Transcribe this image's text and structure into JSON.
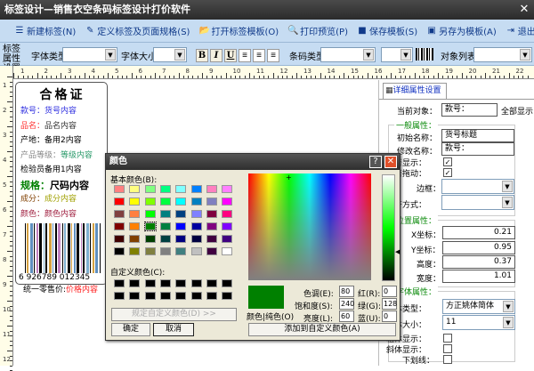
{
  "window": {
    "title": "标签设计—销售衣空条码标签设计打价软件",
    "close": "✕"
  },
  "toolbar": [
    {
      "label": "新建标签(N)",
      "icon": "new-label-icon",
      "glyph": "☰"
    },
    {
      "label": "定义标签及页面规格(S)",
      "icon": "page-setup-icon",
      "glyph": "✎"
    },
    {
      "label": "打开标签模板(O)",
      "icon": "open-folder-icon",
      "glyph": "📂"
    },
    {
      "label": "打印预览(P)",
      "icon": "magnifier-icon",
      "glyph": "🔍"
    },
    {
      "label": "保存模板(S)",
      "icon": "save-icon",
      "glyph": "■"
    },
    {
      "label": "另存为模板(A)",
      "icon": "save-as-icon",
      "glyph": "▣"
    },
    {
      "label": "退出(E)",
      "icon": "exit-icon",
      "glyph": "⇥"
    }
  ],
  "props_bar": {
    "section": "标签属性设置",
    "font_type": "字体类型",
    "font_size": "字体大小",
    "bold": "B",
    "italic": "I",
    "underline": "U",
    "barcode_type": "条码类型",
    "object_list": "对象列表"
  },
  "ruler": [
    "1",
    "2",
    "3",
    "4",
    "5",
    "6",
    "7",
    "8",
    "9",
    "10",
    "11",
    "12",
    "13",
    "14",
    "15",
    "16",
    "17",
    "18",
    "19",
    "20",
    "21",
    "22"
  ],
  "ruler_left": [
    "1",
    "2",
    "3",
    "4",
    "5",
    "6",
    "7",
    "8",
    "9",
    "10",
    "11",
    "12"
  ],
  "label": {
    "title": "合格证",
    "rows": [
      {
        "k": "款号：",
        "v": "货号内容",
        "kc": "#3030e0",
        "vc": "#3030e0"
      },
      {
        "k": "品名：",
        "v": "品名内容",
        "kc": "#ff3030",
        "vc": "#333333"
      },
      {
        "k": "产地：",
        "v": "备用2内容",
        "kc": "#000000",
        "vc": "#000000"
      },
      {
        "k": "产品等级：",
        "v": "等级内容",
        "kc": "#888888",
        "vc": "#2a9a6a"
      },
      {
        "k": "检验员",
        "v": "备用1内容",
        "kc": "#000000",
        "vc": "#000000"
      },
      {
        "k": "规格：",
        "v": "尺码内容",
        "kc": "#008000",
        "vc": "#000000"
      },
      {
        "k": "成分：",
        "v": "成分内容",
        "kc": "#804000",
        "vc": "#a0a000"
      },
      {
        "k": "颜色：",
        "v": "颜色内容",
        "kc": "#a02040",
        "vc": "#a02040"
      }
    ],
    "barcode_number": "6 926789 012345",
    "price_label": "统一零售价:",
    "price_value": "价格内容"
  },
  "panel": {
    "tab": "详细属性设置",
    "current_object_label": "当前对象：",
    "current_object": "款号：",
    "show_all": "全部显示",
    "general": {
      "title": "一般属性：",
      "init_name_label": "初始名称：",
      "init_name": "货号标题",
      "mod_name_label": "修改名称：",
      "mod_name": "款号：",
      "visible_label": "是否显示：",
      "draggable_label": "可否拖动：",
      "border_label": "边框：",
      "align_label": "对齐方式：",
      "visible": true,
      "draggable": true
    },
    "position": {
      "title": "位置属性：",
      "x_label": "X坐标：",
      "x": "0.21",
      "y_label": "Y坐标：",
      "y": "0.95",
      "h_label": "高度：",
      "h": "0.37",
      "w_label": "宽度：",
      "w": "1.01"
    },
    "font": {
      "title": "字体属性：",
      "type_label": "字体类型：",
      "type": "方正姚体简体",
      "size_label": "字体大小：",
      "size": "11",
      "bold_label": "粗体显示：",
      "italic_label": "斜体显示：",
      "underline_label": "下划线："
    }
  },
  "dialog": {
    "title": "颜色",
    "help": "?",
    "close": "✕",
    "basic_label": "基本颜色(B):",
    "basic_colors": [
      "#FF8080",
      "#FFFF80",
      "#80FF80",
      "#00FF80",
      "#80FFFF",
      "#0080FF",
      "#FF80C0",
      "#FF80FF",
      "#FF0000",
      "#FFFF00",
      "#80FF00",
      "#00FF40",
      "#00FFFF",
      "#0080C0",
      "#8080C0",
      "#FF00FF",
      "#804040",
      "#FF8040",
      "#00FF00",
      "#008080",
      "#004080",
      "#8080FF",
      "#800040",
      "#FF0080",
      "#800000",
      "#FF8000",
      "#008000",
      "#008040",
      "#0000FF",
      "#0000A0",
      "#800080",
      "#8000FF",
      "#400000",
      "#804000",
      "#004000",
      "#004040",
      "#000080",
      "#000040",
      "#400040",
      "#400080",
      "#000000",
      "#808000",
      "#808040",
      "#808080",
      "#408080",
      "#C0C0C0",
      "#400040",
      "#FFFFFF"
    ],
    "selected_index": 26,
    "custom_label": "自定义颜色(C):",
    "define_custom": "规定自定义颜色(D) >>",
    "ok": "确定",
    "cancel": "取消",
    "color_solid": "颜色|纯色(O)",
    "hue_label": "色调(E):",
    "hue": "80",
    "sat_label": "饱和度(S):",
    "sat": "240",
    "lum_label": "亮度(L):",
    "lum": "60",
    "red_label": "红(R):",
    "red": "0",
    "green_label": "绿(G):",
    "green": "128",
    "blue_label": "蓝(U):",
    "blue": "0",
    "add_custom": "添加到自定义颜色(A)",
    "current_color": "#008000"
  }
}
